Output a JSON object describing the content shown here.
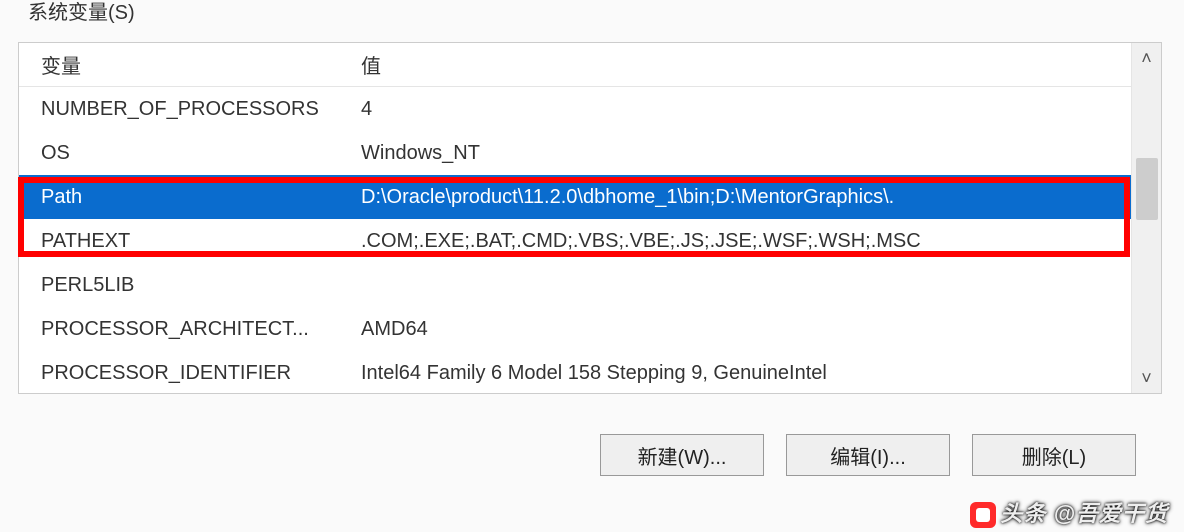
{
  "groupTitle": "系统变量(S)",
  "columns": {
    "name": "变量",
    "value": "值"
  },
  "rows": [
    {
      "name": "NUMBER_OF_PROCESSORS",
      "value": "4",
      "selected": false
    },
    {
      "name": "OS",
      "value": "Windows_NT",
      "selected": false
    },
    {
      "name": "Path",
      "value": "D:\\Oracle\\product\\11.2.0\\dbhome_1\\bin;D:\\MentorGraphics\\.",
      "selected": true
    },
    {
      "name": "PATHEXT",
      "value": ".COM;.EXE;.BAT;.CMD;.VBS;.VBE;.JS;.JSE;.WSF;.WSH;.MSC",
      "selected": false
    },
    {
      "name": "PERL5LIB",
      "value": "",
      "selected": false
    },
    {
      "name": "PROCESSOR_ARCHITECT...",
      "value": "AMD64",
      "selected": false
    },
    {
      "name": "PROCESSOR_IDENTIFIER",
      "value": "Intel64 Family 6 Model 158 Stepping 9, GenuineIntel",
      "selected": false
    }
  ],
  "buttons": {
    "new": "新建(W)...",
    "edit": "编辑(I)...",
    "delete": "删除(L)"
  },
  "scroll": {
    "up": "˄",
    "down": "˅"
  },
  "watermark": "头条 @吾爱干货"
}
